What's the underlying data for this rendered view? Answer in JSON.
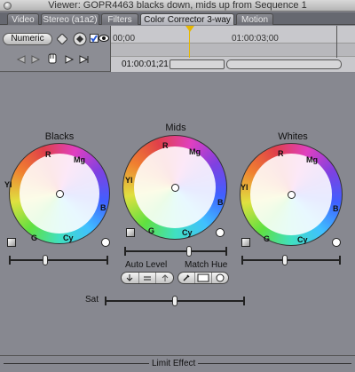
{
  "window": {
    "title": "Viewer: GOPR4463 blacks down, mids up from Sequence 1"
  },
  "tabs": [
    {
      "label": "Video"
    },
    {
      "label": "Stereo (a1a2)"
    },
    {
      "label": "Filters"
    },
    {
      "label": "Color Corrector 3-way"
    },
    {
      "label": "Motion"
    }
  ],
  "toolbar": {
    "numeric_label": "Numeric",
    "ruler_start": "00;00",
    "ruler_mark": "01:00:03;00",
    "current_timecode": "01:00:01;21"
  },
  "wheels": {
    "blacks": {
      "label": "Blacks"
    },
    "mids": {
      "label": "Mids"
    },
    "whites": {
      "label": "Whites"
    },
    "hue_labels": {
      "r": "R",
      "mg": "Mg",
      "b": "B",
      "cy": "Cy",
      "g": "G",
      "yl": "Yl"
    }
  },
  "controls": {
    "auto_level_label": "Auto Level",
    "match_hue_label": "Match Hue",
    "sat_label": "Sat",
    "limit_effect_label": "Limit Effect"
  },
  "colors": {
    "panel_bg": "#878890",
    "active_tab": "#c4c5ca",
    "playhead": "#e6b700"
  },
  "icons": [
    "close-icon",
    "eye-icon",
    "checkbox-icon",
    "reset-icon",
    "eyedropper-icon",
    "swatch-icon",
    "circle-icon"
  ]
}
